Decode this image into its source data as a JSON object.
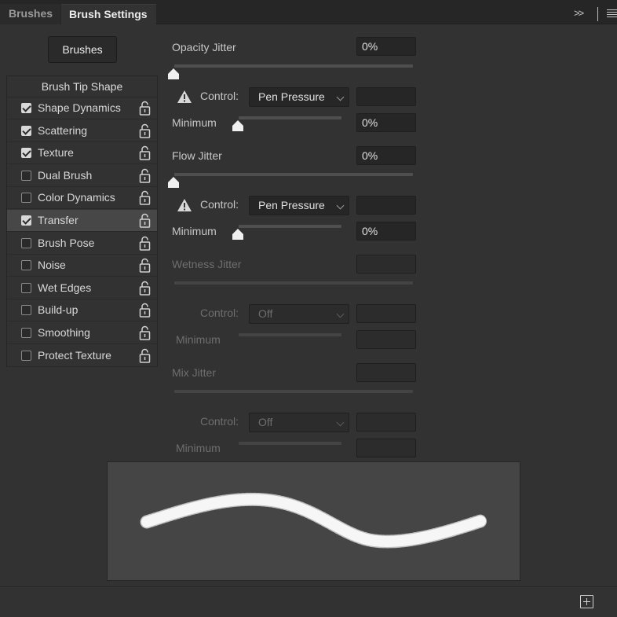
{
  "tabs": [
    {
      "label": "Brushes"
    },
    {
      "label": "Brush Settings"
    }
  ],
  "brushes_button": "Brushes",
  "brush_tip_shape": "Brush Tip Shape",
  "options": [
    {
      "label": "Shape Dynamics",
      "checked": true,
      "selected": false
    },
    {
      "label": "Scattering",
      "checked": true,
      "selected": false
    },
    {
      "label": "Texture",
      "checked": true,
      "selected": false
    },
    {
      "label": "Dual Brush",
      "checked": false,
      "selected": false
    },
    {
      "label": "Color Dynamics",
      "checked": false,
      "selected": false
    },
    {
      "label": "Transfer",
      "checked": true,
      "selected": true
    },
    {
      "label": "Brush Pose",
      "checked": false,
      "selected": false
    },
    {
      "label": "Noise",
      "checked": false,
      "selected": false
    },
    {
      "label": "Wet Edges",
      "checked": false,
      "selected": false
    },
    {
      "label": "Build-up",
      "checked": false,
      "selected": false
    },
    {
      "label": "Smoothing",
      "checked": false,
      "selected": false
    },
    {
      "label": "Protect Texture",
      "checked": false,
      "selected": false
    }
  ],
  "opacity": {
    "label": "Opacity Jitter",
    "value": "0%",
    "control_label": "Control:",
    "control_value": "Pen Pressure",
    "minimum_label": "Minimum",
    "minimum_value": "0%"
  },
  "flow": {
    "label": "Flow Jitter",
    "value": "0%",
    "control_label": "Control:",
    "control_value": "Pen Pressure",
    "minimum_label": "Minimum",
    "minimum_value": "0%"
  },
  "wetness": {
    "label": "Wetness Jitter",
    "value": "",
    "control_label": "Control:",
    "control_value": "Off",
    "minimum_label": "Minimum",
    "minimum_value": ""
  },
  "mix": {
    "label": "Mix Jitter",
    "value": "",
    "control_label": "Control:",
    "control_value": "Off",
    "minimum_label": "Minimum",
    "minimum_value": ""
  }
}
